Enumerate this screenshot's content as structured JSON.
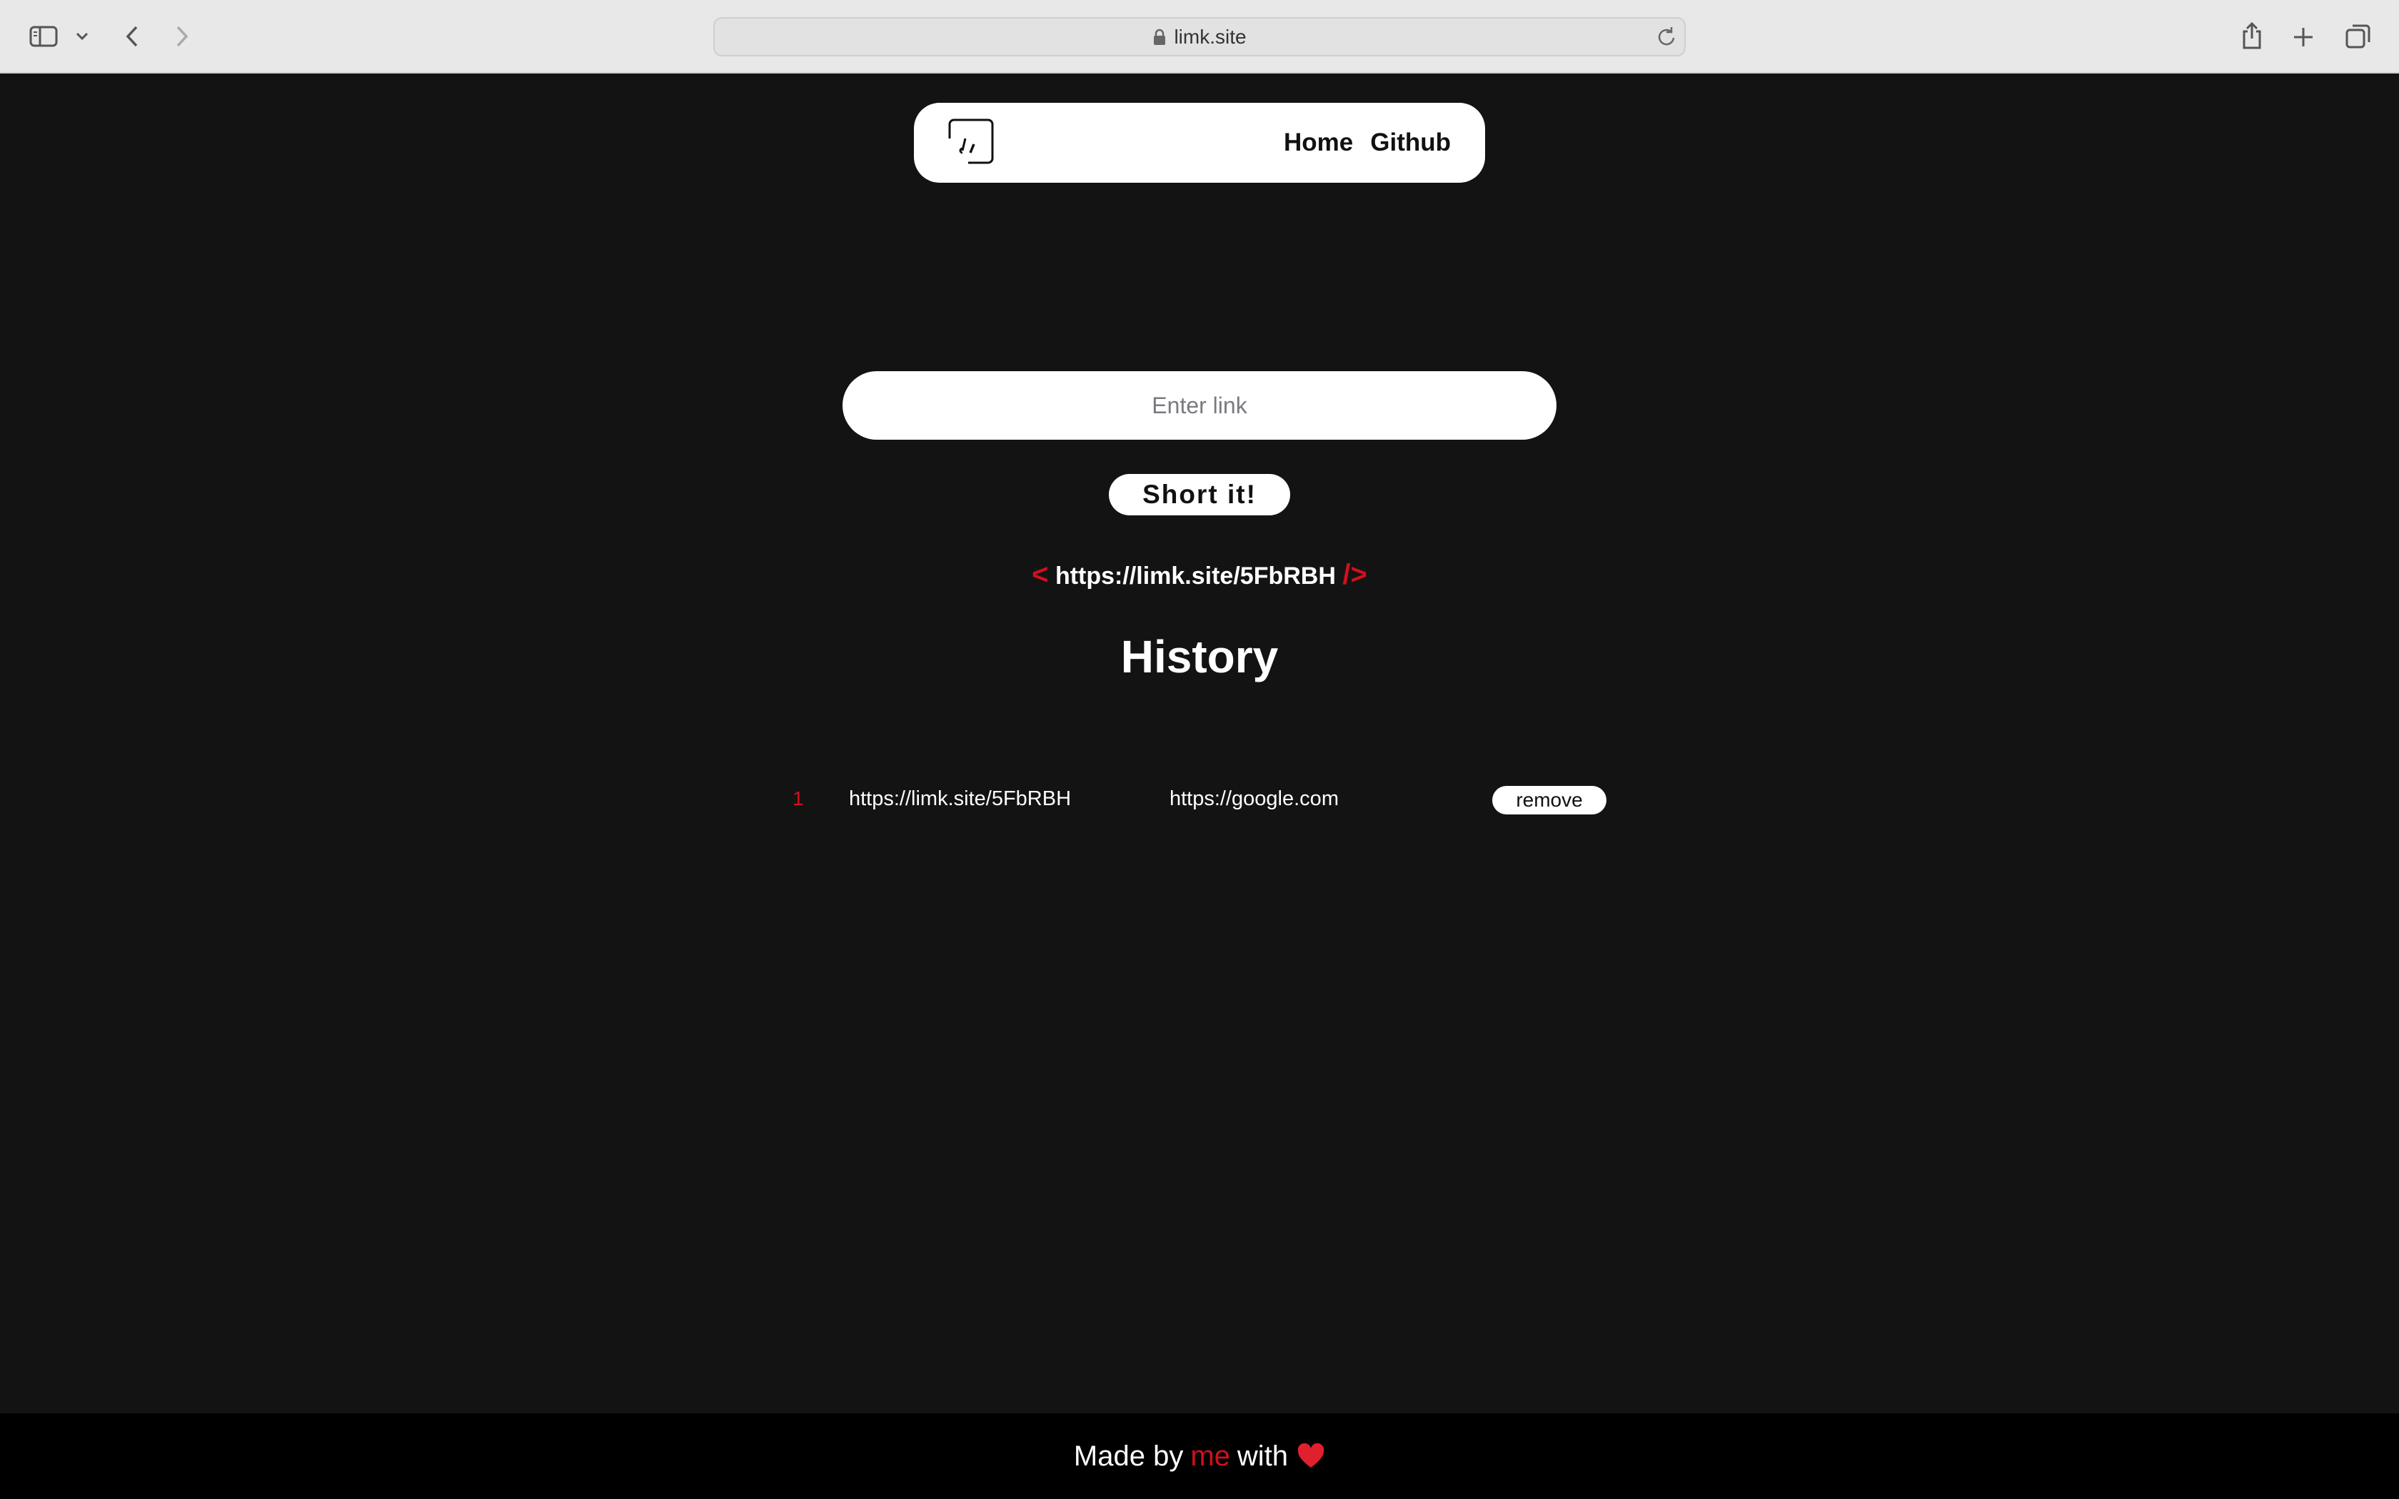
{
  "browser": {
    "url": "limk.site",
    "icons": [
      "sidebar-icon",
      "chevron-down-icon",
      "back-icon",
      "forward-icon",
      "lock-icon",
      "reload-icon",
      "share-icon",
      "new-tab-icon",
      "tabs-overview-icon"
    ]
  },
  "nav": {
    "home_label": "Home",
    "github_label": "Github"
  },
  "shortener": {
    "input_placeholder": "Enter link",
    "submit_label": "Short it!",
    "result_open": "<",
    "result_url": "https://limk.site/5FbRBH",
    "result_close": "/>"
  },
  "history": {
    "title": "History",
    "rows": [
      {
        "index": "1",
        "short_url": "https://limk.site/5FbRBH",
        "original_url": "https://google.com",
        "remove_label": "remove"
      }
    ]
  },
  "footer": {
    "prefix": "Made by",
    "author": "me",
    "suffix": "with"
  },
  "colors": {
    "background": "#131313",
    "accent": "#d0101c",
    "footer": "#000000"
  }
}
